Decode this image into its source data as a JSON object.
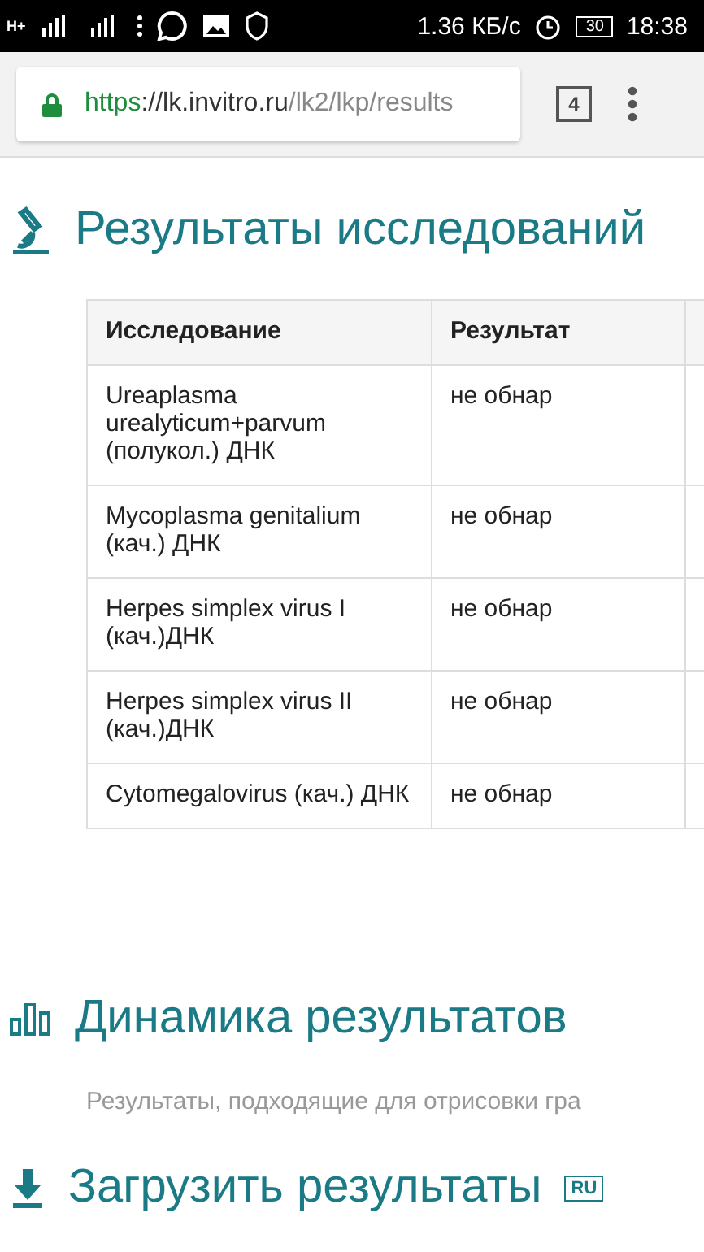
{
  "status_bar": {
    "network": "H+",
    "speed": "1.36 КБ/с",
    "battery": "30",
    "time": "18:38"
  },
  "browser": {
    "url_scheme": "https",
    "url_host": "://lk.invitro.ru",
    "url_path": "/lk2/lkp/results",
    "tab_count": "4"
  },
  "results_section": {
    "title": "Результаты исследований",
    "columns": [
      "Исследование",
      "Результат"
    ],
    "rows": [
      {
        "test": "Ureaplasma urealyticum+parvum (полукол.) ДНК",
        "result": "не обнар"
      },
      {
        "test": "Mycoplasma genitalium (кач.) ДНК",
        "result": "не обнар"
      },
      {
        "test": "Herpes simplex virus I (кач.)ДНК",
        "result": "не обнар"
      },
      {
        "test": "Herpes simplex virus II (кач.)ДНК",
        "result": "не обнар"
      },
      {
        "test": "Cytomegalovirus (кач.) ДНК",
        "result": "не обнар"
      }
    ]
  },
  "dynamics_section": {
    "title": "Динамика результатов",
    "text": "Результаты, подходящие для отрисовки гра"
  },
  "download_section": {
    "title": "Загрузить результаты",
    "badge": "RU"
  }
}
